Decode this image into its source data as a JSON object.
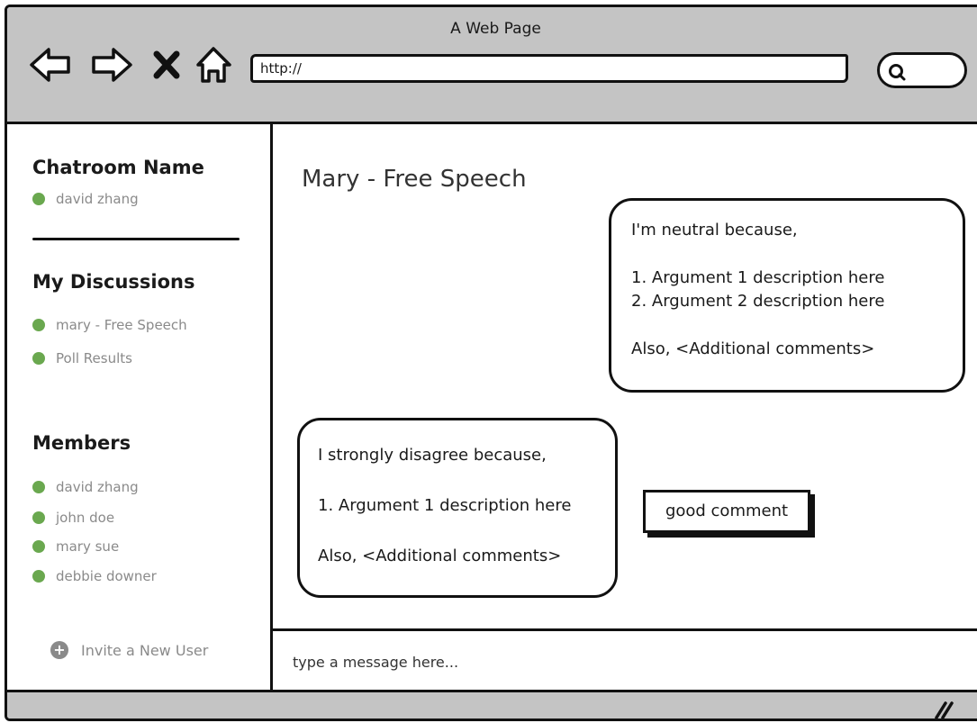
{
  "window": {
    "title": "A Web Page"
  },
  "browser": {
    "url": "http://",
    "search": ""
  },
  "sidebar": {
    "chatroom_heading": "Chatroom Name",
    "chatroom_user": "david zhang",
    "discussions_heading": "My Discussions",
    "discussions": [
      "mary - Free Speech",
      "Poll Results"
    ],
    "members_heading": "Members",
    "members": [
      "david zhang",
      "john doe",
      "mary sue",
      "debbie downer"
    ],
    "invite_label": "Invite a New User"
  },
  "main": {
    "title": "Mary - Free Speech",
    "messages": [
      {
        "intro": "I'm neutral because,",
        "args": [
          "1. Argument 1 description here",
          "2. Argument 2 description here"
        ],
        "extra": "Also, <Additional comments>"
      },
      {
        "intro": "I strongly disagree because,",
        "args": [
          "1. Argument 1 description here"
        ],
        "extra": "Also, <Additional comments>"
      }
    ],
    "good_comment_label": "good comment",
    "composer_placeholder": "type a message here..."
  },
  "colors": {
    "status_dot": "#6aa84f",
    "chrome": "#c4c4c4",
    "muted_text": "#8a8a8a"
  }
}
